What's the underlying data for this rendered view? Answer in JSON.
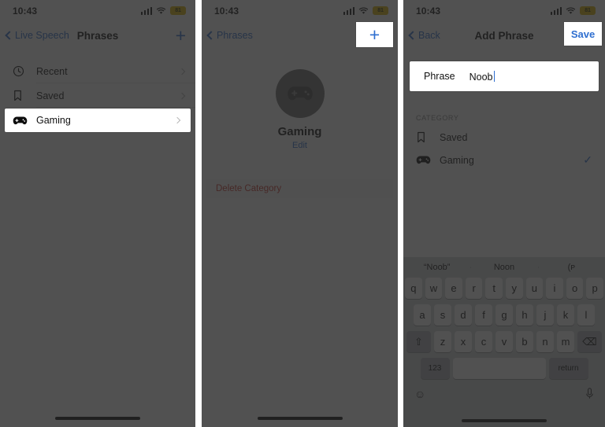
{
  "status_bar": {
    "time": "10:43",
    "battery_label": "81",
    "icons": [
      "cellular-signal-icon",
      "wifi-icon",
      "battery-icon"
    ]
  },
  "panel1": {
    "nav": {
      "back_label": "Live Speech",
      "title": "Phrases",
      "add_label": "+"
    },
    "rows": [
      {
        "icon": "clock-icon",
        "label": "Recent"
      },
      {
        "icon": "bookmark-icon",
        "label": "Saved"
      }
    ],
    "highlighted_row": {
      "icon": "gamepad-icon",
      "label": "Gaming"
    }
  },
  "panel2": {
    "nav": {
      "back_label": "Phrases",
      "title": "",
      "add_label": "+"
    },
    "avatar_icon": "gamepad-icon",
    "category_name": "Gaming",
    "edit_label": "Edit",
    "delete_label": "Delete Category"
  },
  "panel3": {
    "nav": {
      "back_label": "Back",
      "title": "Add Phrase",
      "save_label": "Save"
    },
    "phrase_field": {
      "label": "Phrase",
      "value": "Noob",
      "placeholder": "Phrase"
    },
    "section_header": "CATEGORY",
    "categories": [
      {
        "icon": "bookmark-icon",
        "label": "Saved",
        "selected": false
      },
      {
        "icon": "gamepad-icon",
        "label": "Gaming",
        "selected": true
      }
    ],
    "check_glyph": "✓",
    "keyboard": {
      "predictions": [
        "“Noob”",
        "Noon",
        "(ᴘ"
      ],
      "row1": [
        "q",
        "w",
        "e",
        "r",
        "t",
        "y",
        "u",
        "i",
        "o",
        "p"
      ],
      "row2": [
        "a",
        "s",
        "d",
        "f",
        "g",
        "h",
        "j",
        "k",
        "l"
      ],
      "row3": [
        "z",
        "x",
        "c",
        "v",
        "b",
        "n",
        "m"
      ],
      "shift_label": "⇧",
      "backspace_label": "⌫",
      "numeric_label": "123",
      "space_label": "",
      "return_label": "return",
      "emoji_label": "☺",
      "mic_label": "Ἲ4"
    }
  },
  "colors": {
    "accent": "#2f6fd0",
    "destructive": "#c8342c",
    "battery": "#d9b500",
    "veil": "rgba(38,38,38,0.80)"
  }
}
